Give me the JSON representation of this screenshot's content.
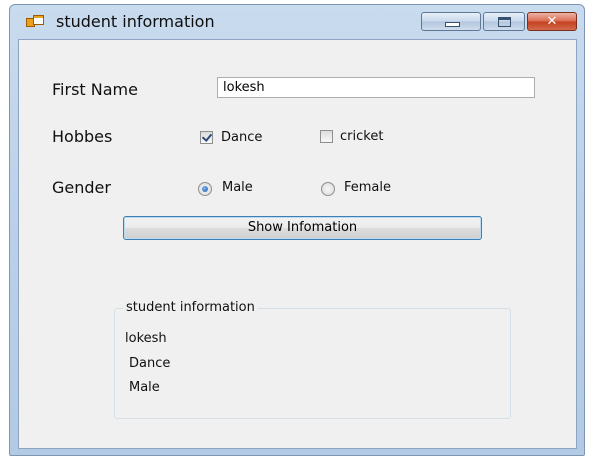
{
  "window": {
    "title": "student information",
    "close_glyph": "✕",
    "icons": [
      "app-icon",
      "minimize-icon",
      "maximize-icon",
      "close-icon"
    ]
  },
  "form": {
    "first_name_label": "First Name",
    "first_name_value": "lokesh",
    "hobbies_label": "Hobbes",
    "hobbies": [
      {
        "label": "Dance",
        "checked": true
      },
      {
        "label": "cricket",
        "checked": false
      }
    ],
    "gender_label": "Gender",
    "genders": [
      {
        "label": "Male",
        "selected": true
      },
      {
        "label": "Female",
        "selected": false
      }
    ],
    "show_button_label": "Show Infomation"
  },
  "output_group": {
    "title": "student information",
    "lines": [
      "lokesh",
      " Dance",
      " Male"
    ]
  },
  "colors": {
    "form_background": "#f0f0f0",
    "window_frame": "#bcd1e8",
    "button_focus_border": "#3c7fb1",
    "close_button": "#c2401f"
  }
}
